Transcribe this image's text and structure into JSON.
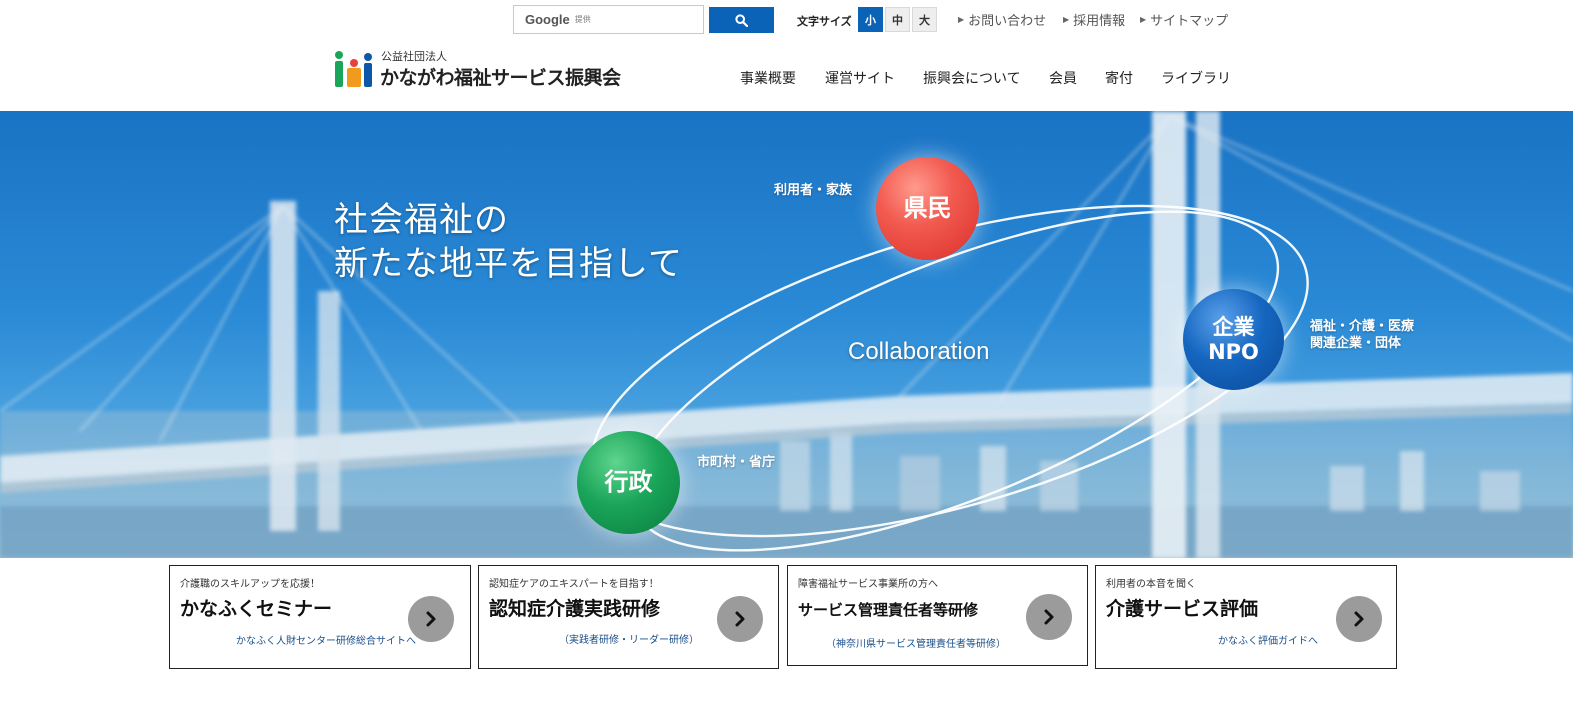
{
  "search": {
    "google_label": "Google",
    "provided_label": "提供",
    "button_icon": "search-icon"
  },
  "font_size": {
    "label": "文字サイズ",
    "options": [
      "小",
      "中",
      "大"
    ],
    "active": "小"
  },
  "util_links": [
    "お問い合わせ",
    "採用情報",
    "サイトマップ"
  ],
  "logo": {
    "sub": "公益社団法人",
    "name": "かながわ福祉サービス振興会"
  },
  "nav": [
    "事業概要",
    "運営サイト",
    "振興会について",
    "会員",
    "寄付",
    "ライブラリ"
  ],
  "hero": {
    "catch_line1": "社会福祉の",
    "catch_line2": "新たな地平を目指して",
    "collaboration": "Collaboration",
    "citizen": {
      "ball": "県民",
      "label": "利用者・家族"
    },
    "company": {
      "ball_line1": "企業",
      "ball_line2": "NPO",
      "label_line1": "福祉・介護・医療",
      "label_line2": "関連企業・団体"
    },
    "government": {
      "ball": "行政",
      "label": "市町村・省庁"
    },
    "colors": {
      "citizen": "#e8413a",
      "company": "#0d57a8",
      "government": "#139a4c"
    }
  },
  "cards": [
    {
      "kicker": "介護職のスキルアップを応援！",
      "title": "かなふくセミナー",
      "note": "かなふく人財センター研修総合サイトへ"
    },
    {
      "kicker": "認知症ケアのエキスパートを目指す！",
      "title": "認知症介護実践研修",
      "note": "（実践者研修・リーダー研修）"
    },
    {
      "kicker": "障害福祉サービス事業所の方へ",
      "title": "サービス管理責任者等研修",
      "note": "（神奈川県サービス管理責任者等研修）"
    },
    {
      "kicker": "利用者の本音を聞く",
      "title": "介護サービス評価",
      "note": "かなふく評価ガイドへ"
    }
  ],
  "accent_color": "#0b63b7"
}
